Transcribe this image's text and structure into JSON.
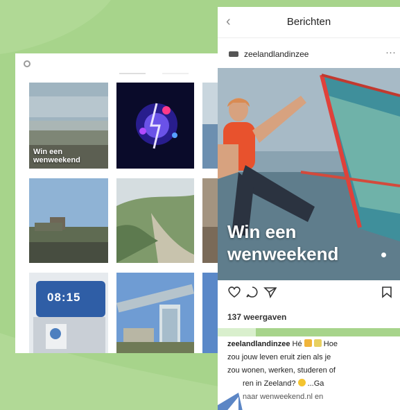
{
  "phone": {
    "nav_title": "Berichten",
    "back_glyph": "‹",
    "username": "zeelandlandinzee",
    "more_glyph": "···",
    "hero_line1": "Win een",
    "hero_line2": "wenweekend",
    "views_text": "137 weergaven",
    "caption": {
      "username": "zeelandlandinzee",
      "line1_after": " Hé",
      "line1_end": " Hoe",
      "line2": "zou jouw leven eruit zien als je",
      "line3": "zou wonen, werken, studeren of",
      "line4_a": "ren in Zeeland?",
      "line4_b": " ...Ga",
      "line5": "naar wenweekend.nl en"
    }
  },
  "grid": {
    "tile1_caption_line1": "Win een",
    "tile1_caption_line2": "wenweekend",
    "tile7_clock": "08:15"
  },
  "colors": {
    "background": "#a7d48b",
    "wave_shape": "#cfe8ba"
  },
  "icons": [
    "back-icon",
    "more-icon",
    "heart-icon",
    "comment-icon",
    "share-icon",
    "bookmark-icon",
    "gear-icon"
  ]
}
